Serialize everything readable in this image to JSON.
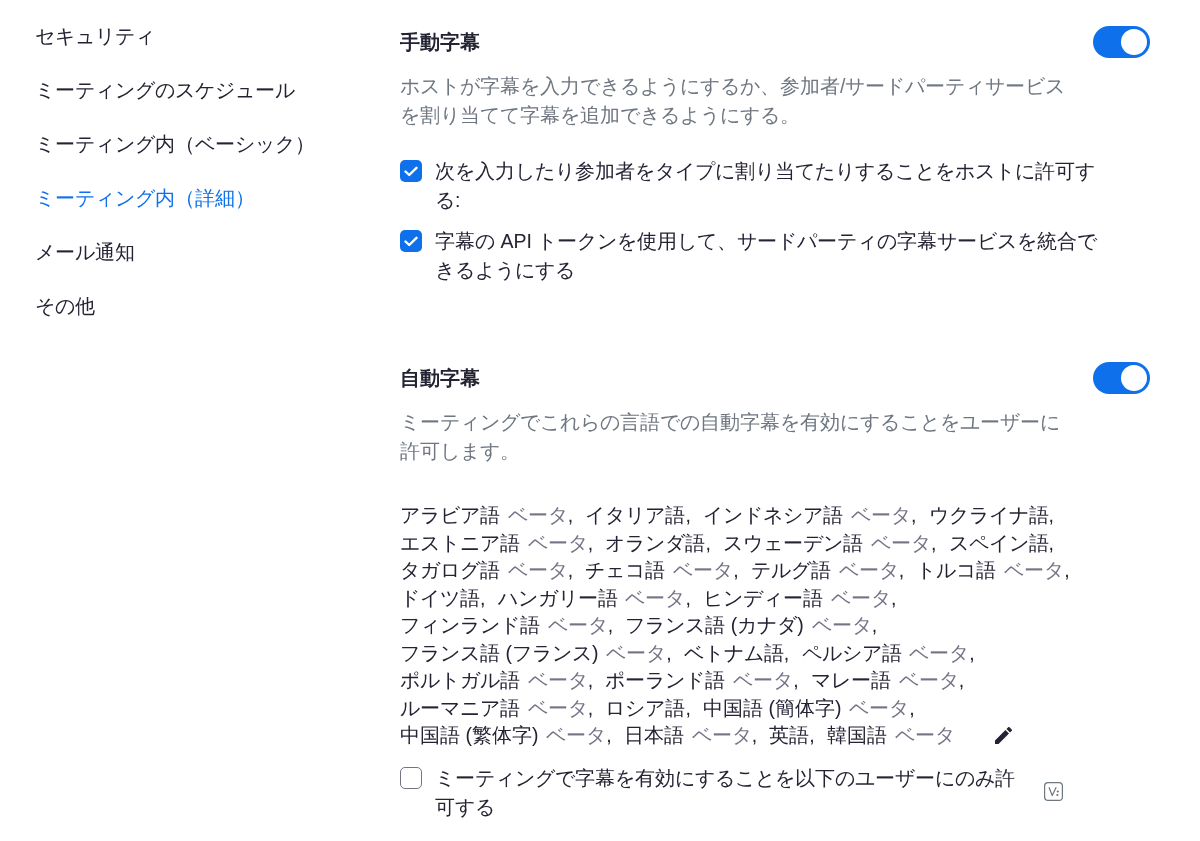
{
  "sidebar": {
    "items": [
      {
        "label": "セキュリティ",
        "selected": false
      },
      {
        "label": "ミーティングのスケジュール",
        "selected": false
      },
      {
        "label": "ミーティング内（ベーシック）",
        "selected": false
      },
      {
        "label": "ミーティング内（詳細）",
        "selected": true
      },
      {
        "label": "メール通知",
        "selected": false
      },
      {
        "label": "その他",
        "selected": false
      }
    ]
  },
  "manual_captions": {
    "title": "手動字幕",
    "on": true,
    "description": "ホストが字幕を入力できるようにするか、参加者/サードパーティサービスを割り当てて字幕を追加できるようにする。",
    "options": [
      {
        "label": "次を入力したり参加者をタイプに割り当てたりすることをホストに許可する:",
        "checked": true
      },
      {
        "label": "字幕の API トークンを使用して、サードパーティの字幕サービスを統合できるようにする",
        "checked": true
      }
    ]
  },
  "auto_captions": {
    "title": "自動字幕",
    "on": true,
    "description": "ミーティングでこれらの言語での自動字幕を有効にすることをユーザーに許可します。",
    "languages": [
      {
        "name": "アラビア語",
        "tag": "ベータ",
        "separator": ","
      },
      {
        "name": "イタリア語",
        "separator": ","
      },
      {
        "name": "インドネシア語",
        "tag": "ベータ",
        "separator": ","
      },
      {
        "name": "ウクライナ語",
        "separator": ","
      },
      {
        "name": "エストニア語",
        "tag": "ベータ",
        "separator": ","
      },
      {
        "name": "オランダ語",
        "separator": ","
      },
      {
        "name": "スウェーデン語",
        "tag": "ベータ",
        "separator": ","
      },
      {
        "name": "スペイン語",
        "separator": ","
      },
      {
        "name": "タガログ語",
        "tag": "ベータ",
        "separator": ","
      },
      {
        "name": "チェコ語",
        "tag": "ベータ",
        "separator": ","
      },
      {
        "name": "テルグ語",
        "tag": "ベータ",
        "separator": ","
      },
      {
        "name": "トルコ語",
        "tag": "ベータ",
        "separator": ","
      },
      {
        "name": "ドイツ語",
        "separator": ","
      },
      {
        "name": "ハンガリー語",
        "tag": "ベータ",
        "separator": ","
      },
      {
        "name": "ヒンディー語",
        "tag": "ベータ",
        "separator": ","
      },
      {
        "name": "フィンランド語",
        "tag": "ベータ",
        "separator": ","
      },
      {
        "name": "フランス語 (カナダ)",
        "tag": "ベータ",
        "separator": ","
      },
      {
        "name": "フランス語 (フランス)",
        "tag": "ベータ",
        "separator": ","
      },
      {
        "name": "ベトナム語",
        "separator": ","
      },
      {
        "name": "ペルシア語",
        "tag": "ベータ",
        "separator": ","
      },
      {
        "name": "ポルトガル語",
        "tag": "ベータ",
        "separator": ","
      },
      {
        "name": "ポーランド語",
        "tag": "ベータ",
        "separator": ","
      },
      {
        "name": "マレー語",
        "tag": "ベータ",
        "separator": ","
      },
      {
        "name": "ルーマニア語",
        "tag": "ベータ",
        "separator": ","
      },
      {
        "name": "ロシア語",
        "separator": ","
      },
      {
        "name": "中国語 (簡体字)",
        "tag": "ベータ",
        "separator": ","
      },
      {
        "name": "中国語 (繁体字)",
        "tag": "ベータ",
        "separator": ","
      },
      {
        "name": "日本語",
        "tag": "ベータ",
        "separator": ","
      },
      {
        "name": "英語",
        "separator": ","
      },
      {
        "name": "韓国語",
        "tag": "ベータ"
      }
    ],
    "restriction": {
      "label": "ミーティングで字幕を有効にすることを以下のユーザーにのみ許可する",
      "checked": false
    }
  }
}
